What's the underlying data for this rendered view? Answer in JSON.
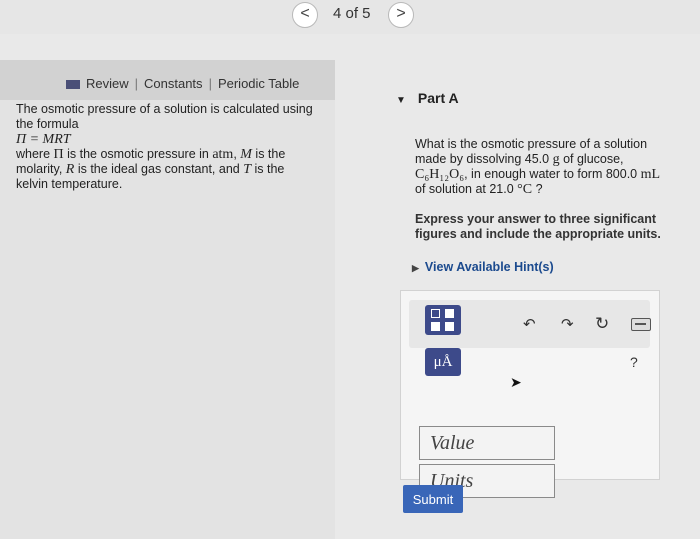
{
  "nav": {
    "prev_glyph": "<",
    "next_glyph": ">",
    "pager": "4 of 5"
  },
  "toolbar": {
    "review": "Review",
    "sep": "|",
    "constants": "Constants",
    "periodic_table": "Periodic Table"
  },
  "intro": {
    "line1": "The osmotic pressure of a solution is calculated using the formula",
    "formula": "Π = MRT",
    "where_a": "where ",
    "pi": "Π",
    "where_b": " is the osmotic pressure in ",
    "atm": "atm",
    "where_c": ", ",
    "M": "M",
    "where_d": " is the molarity, ",
    "R": "R",
    "where_e": " is the ideal gas constant, and ",
    "T": "T",
    "where_f": " is the kelvin temperature."
  },
  "part": {
    "title": "Part A"
  },
  "question": {
    "a": "What is the osmotic pressure of a solution made by dissolving 45.0 ",
    "g": "g",
    "b": " of glucose, ",
    "formula": "C₆H₁₂O₆",
    "c": ", in enough water to form 800.0 ",
    "mL": "mL",
    "d": " of solution at 21.0 ",
    "degC": "°C",
    "e": " ?"
  },
  "instructions": "Express your answer to three significant figures and include the appropriate units.",
  "hint": "View Available Hint(s)",
  "answer": {
    "mu_label": "μÅ",
    "help": "?",
    "value_placeholder": "Value",
    "units_placeholder": "Units",
    "undo_glyph": "↶",
    "redo_glyph": "↷",
    "reset_glyph": "↻"
  },
  "submit": "Submit",
  "colors": {
    "accent": "#3d4a8a",
    "submit": "#3966b8",
    "link": "#1b4a8e"
  }
}
